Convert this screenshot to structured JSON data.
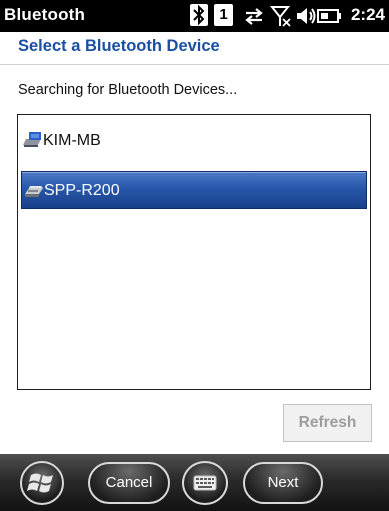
{
  "statusbar": {
    "app_title": "Bluetooth",
    "num_badge": "1",
    "clock": "2:24",
    "icons": [
      "bluetooth-icon",
      "notification-badge",
      "data-sync-icon",
      "signal-off-icon",
      "speaker-icon",
      "battery-icon"
    ]
  },
  "header": {
    "title": "Select a Bluetooth Device",
    "title_color": "#1b4fa3"
  },
  "status_text": "Searching for Bluetooth Devices...",
  "devices": [
    {
      "label": "KIM-MB",
      "icon": "computer-icon",
      "selected": false
    },
    {
      "label": "SPP-R200",
      "icon": "printer-icon",
      "selected": true
    }
  ],
  "refresh": {
    "label": "Refresh",
    "enabled": false
  },
  "softbar": {
    "cancel_label": "Cancel",
    "next_label": "Next",
    "icons": [
      "windows-start-icon",
      "keyboard-icon"
    ]
  },
  "colors": {
    "selection": "#2857a9",
    "accent": "#1b4fa3",
    "statusbar_bg": "#000000"
  }
}
